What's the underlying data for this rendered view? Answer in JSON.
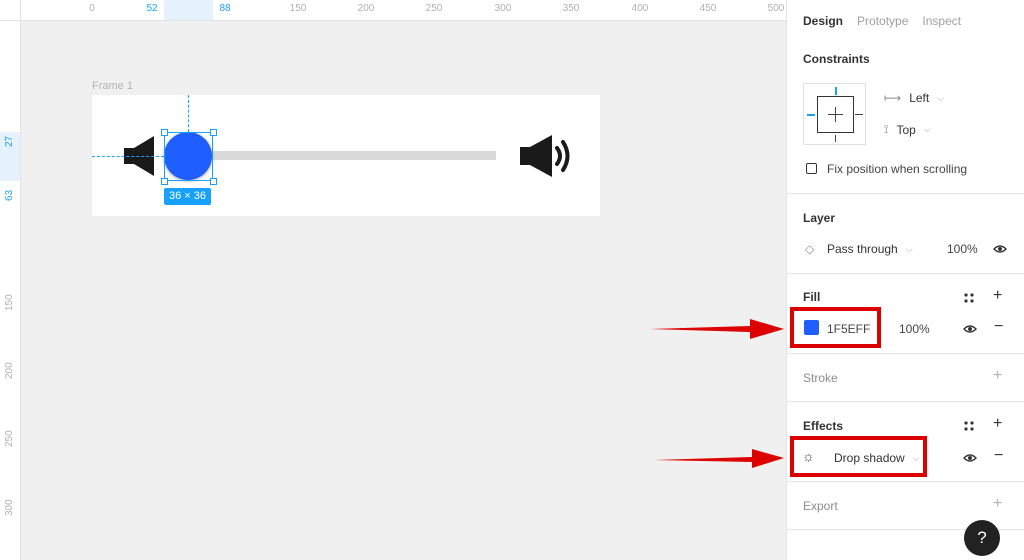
{
  "canvas": {
    "ruler_top_ticks": [
      "0",
      "52",
      "88",
      "150",
      "200",
      "250",
      "300",
      "350",
      "400",
      "450",
      "500"
    ],
    "ruler_left_ticks": [
      "27",
      "63",
      "150",
      "200",
      "250",
      "300"
    ],
    "frame_label": "Frame 1",
    "size_badge": "36 × 36"
  },
  "tabs": [
    "Design",
    "Prototype",
    "Inspect"
  ],
  "constraints": {
    "title": "Constraints",
    "horizontal": "Left",
    "vertical": "Top",
    "fix_position_label": "Fix position when scrolling"
  },
  "layer": {
    "title": "Layer",
    "blend_mode": "Pass through",
    "opacity": "100%"
  },
  "fill": {
    "title": "Fill",
    "hex": "1F5EFF",
    "opacity": "100%",
    "swatch_color": "#1F5EFF"
  },
  "stroke": {
    "title": "Stroke"
  },
  "effects": {
    "title": "Effects",
    "effect": "Drop shadow"
  },
  "export": {
    "title": "Export"
  },
  "help": {
    "label": "?"
  },
  "colors": {
    "accent": "#18a0fb",
    "knob": "#1f5eff",
    "highlight_red": "#dd0000"
  }
}
